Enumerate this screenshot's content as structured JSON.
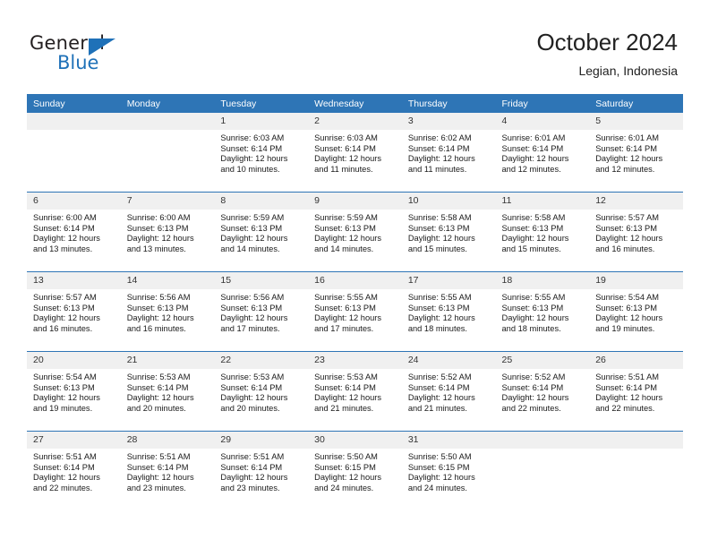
{
  "brand": {
    "name_part1": "General",
    "name_part2": "Blue",
    "triangle_color": "#1f71b8"
  },
  "header": {
    "title": "October 2024",
    "subtitle": "Legian, Indonesia"
  },
  "theme": {
    "header_blue": "#2e75b6",
    "daynum_strip": "#f0f0f0",
    "text": "#1a1a1a"
  },
  "weekdays": [
    "Sunday",
    "Monday",
    "Tuesday",
    "Wednesday",
    "Thursday",
    "Friday",
    "Saturday"
  ],
  "labels": {
    "sunrise_prefix": "Sunrise:",
    "sunset_prefix": "Sunset:",
    "daylight_prefix": "Daylight:"
  },
  "weeks": [
    [
      {
        "day": "",
        "blank": true
      },
      {
        "day": "",
        "blank": true
      },
      {
        "day": "1",
        "sunrise": "Sunrise: 6:03 AM",
        "sunset": "Sunset: 6:14 PM",
        "daylight_line1": "Daylight: 12 hours",
        "daylight_line2": "and 10 minutes."
      },
      {
        "day": "2",
        "sunrise": "Sunrise: 6:03 AM",
        "sunset": "Sunset: 6:14 PM",
        "daylight_line1": "Daylight: 12 hours",
        "daylight_line2": "and 11 minutes."
      },
      {
        "day": "3",
        "sunrise": "Sunrise: 6:02 AM",
        "sunset": "Sunset: 6:14 PM",
        "daylight_line1": "Daylight: 12 hours",
        "daylight_line2": "and 11 minutes."
      },
      {
        "day": "4",
        "sunrise": "Sunrise: 6:01 AM",
        "sunset": "Sunset: 6:14 PM",
        "daylight_line1": "Daylight: 12 hours",
        "daylight_line2": "and 12 minutes."
      },
      {
        "day": "5",
        "sunrise": "Sunrise: 6:01 AM",
        "sunset": "Sunset: 6:14 PM",
        "daylight_line1": "Daylight: 12 hours",
        "daylight_line2": "and 12 minutes."
      }
    ],
    [
      {
        "day": "6",
        "sunrise": "Sunrise: 6:00 AM",
        "sunset": "Sunset: 6:14 PM",
        "daylight_line1": "Daylight: 12 hours",
        "daylight_line2": "and 13 minutes."
      },
      {
        "day": "7",
        "sunrise": "Sunrise: 6:00 AM",
        "sunset": "Sunset: 6:13 PM",
        "daylight_line1": "Daylight: 12 hours",
        "daylight_line2": "and 13 minutes."
      },
      {
        "day": "8",
        "sunrise": "Sunrise: 5:59 AM",
        "sunset": "Sunset: 6:13 PM",
        "daylight_line1": "Daylight: 12 hours",
        "daylight_line2": "and 14 minutes."
      },
      {
        "day": "9",
        "sunrise": "Sunrise: 5:59 AM",
        "sunset": "Sunset: 6:13 PM",
        "daylight_line1": "Daylight: 12 hours",
        "daylight_line2": "and 14 minutes."
      },
      {
        "day": "10",
        "sunrise": "Sunrise: 5:58 AM",
        "sunset": "Sunset: 6:13 PM",
        "daylight_line1": "Daylight: 12 hours",
        "daylight_line2": "and 15 minutes."
      },
      {
        "day": "11",
        "sunrise": "Sunrise: 5:58 AM",
        "sunset": "Sunset: 6:13 PM",
        "daylight_line1": "Daylight: 12 hours",
        "daylight_line2": "and 15 minutes."
      },
      {
        "day": "12",
        "sunrise": "Sunrise: 5:57 AM",
        "sunset": "Sunset: 6:13 PM",
        "daylight_line1": "Daylight: 12 hours",
        "daylight_line2": "and 16 minutes."
      }
    ],
    [
      {
        "day": "13",
        "sunrise": "Sunrise: 5:57 AM",
        "sunset": "Sunset: 6:13 PM",
        "daylight_line1": "Daylight: 12 hours",
        "daylight_line2": "and 16 minutes."
      },
      {
        "day": "14",
        "sunrise": "Sunrise: 5:56 AM",
        "sunset": "Sunset: 6:13 PM",
        "daylight_line1": "Daylight: 12 hours",
        "daylight_line2": "and 16 minutes."
      },
      {
        "day": "15",
        "sunrise": "Sunrise: 5:56 AM",
        "sunset": "Sunset: 6:13 PM",
        "daylight_line1": "Daylight: 12 hours",
        "daylight_line2": "and 17 minutes."
      },
      {
        "day": "16",
        "sunrise": "Sunrise: 5:55 AM",
        "sunset": "Sunset: 6:13 PM",
        "daylight_line1": "Daylight: 12 hours",
        "daylight_line2": "and 17 minutes."
      },
      {
        "day": "17",
        "sunrise": "Sunrise: 5:55 AM",
        "sunset": "Sunset: 6:13 PM",
        "daylight_line1": "Daylight: 12 hours",
        "daylight_line2": "and 18 minutes."
      },
      {
        "day": "18",
        "sunrise": "Sunrise: 5:55 AM",
        "sunset": "Sunset: 6:13 PM",
        "daylight_line1": "Daylight: 12 hours",
        "daylight_line2": "and 18 minutes."
      },
      {
        "day": "19",
        "sunrise": "Sunrise: 5:54 AM",
        "sunset": "Sunset: 6:13 PM",
        "daylight_line1": "Daylight: 12 hours",
        "daylight_line2": "and 19 minutes."
      }
    ],
    [
      {
        "day": "20",
        "sunrise": "Sunrise: 5:54 AM",
        "sunset": "Sunset: 6:13 PM",
        "daylight_line1": "Daylight: 12 hours",
        "daylight_line2": "and 19 minutes."
      },
      {
        "day": "21",
        "sunrise": "Sunrise: 5:53 AM",
        "sunset": "Sunset: 6:14 PM",
        "daylight_line1": "Daylight: 12 hours",
        "daylight_line2": "and 20 minutes."
      },
      {
        "day": "22",
        "sunrise": "Sunrise: 5:53 AM",
        "sunset": "Sunset: 6:14 PM",
        "daylight_line1": "Daylight: 12 hours",
        "daylight_line2": "and 20 minutes."
      },
      {
        "day": "23",
        "sunrise": "Sunrise: 5:53 AM",
        "sunset": "Sunset: 6:14 PM",
        "daylight_line1": "Daylight: 12 hours",
        "daylight_line2": "and 21 minutes."
      },
      {
        "day": "24",
        "sunrise": "Sunrise: 5:52 AM",
        "sunset": "Sunset: 6:14 PM",
        "daylight_line1": "Daylight: 12 hours",
        "daylight_line2": "and 21 minutes."
      },
      {
        "day": "25",
        "sunrise": "Sunrise: 5:52 AM",
        "sunset": "Sunset: 6:14 PM",
        "daylight_line1": "Daylight: 12 hours",
        "daylight_line2": "and 22 minutes."
      },
      {
        "day": "26",
        "sunrise": "Sunrise: 5:51 AM",
        "sunset": "Sunset: 6:14 PM",
        "daylight_line1": "Daylight: 12 hours",
        "daylight_line2": "and 22 minutes."
      }
    ],
    [
      {
        "day": "27",
        "sunrise": "Sunrise: 5:51 AM",
        "sunset": "Sunset: 6:14 PM",
        "daylight_line1": "Daylight: 12 hours",
        "daylight_line2": "and 22 minutes."
      },
      {
        "day": "28",
        "sunrise": "Sunrise: 5:51 AM",
        "sunset": "Sunset: 6:14 PM",
        "daylight_line1": "Daylight: 12 hours",
        "daylight_line2": "and 23 minutes."
      },
      {
        "day": "29",
        "sunrise": "Sunrise: 5:51 AM",
        "sunset": "Sunset: 6:14 PM",
        "daylight_line1": "Daylight: 12 hours",
        "daylight_line2": "and 23 minutes."
      },
      {
        "day": "30",
        "sunrise": "Sunrise: 5:50 AM",
        "sunset": "Sunset: 6:15 PM",
        "daylight_line1": "Daylight: 12 hours",
        "daylight_line2": "and 24 minutes."
      },
      {
        "day": "31",
        "sunrise": "Sunrise: 5:50 AM",
        "sunset": "Sunset: 6:15 PM",
        "daylight_line1": "Daylight: 12 hours",
        "daylight_line2": "and 24 minutes."
      },
      {
        "day": "",
        "blank": true
      },
      {
        "day": "",
        "blank": true
      }
    ]
  ]
}
